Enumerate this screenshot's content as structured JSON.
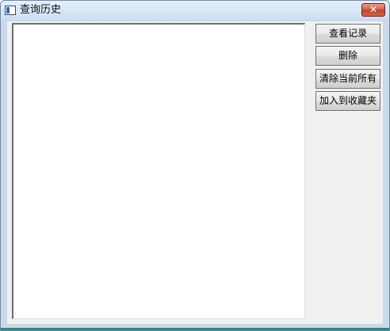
{
  "window": {
    "title": "查询历史",
    "close_label": "✕"
  },
  "buttons": {
    "view_record": "查看记录",
    "delete": "删除",
    "clear_all": "清除当前所有",
    "add_to_favorites": "加入到收藏夹"
  }
}
